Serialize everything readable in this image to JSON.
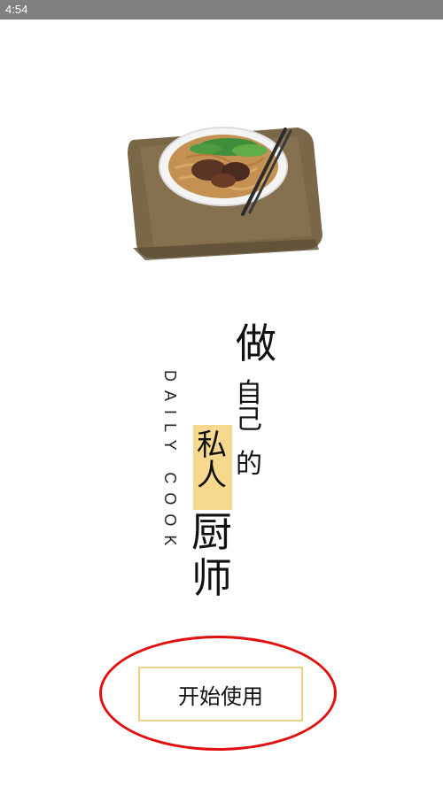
{
  "status_bar": {
    "time": "4:54"
  },
  "hero": {
    "english_title": "DAILY COOK",
    "chinese_lines": [
      "做",
      "自己",
      "的",
      "私人",
      "厨",
      "师"
    ]
  },
  "start_button": {
    "label": "开始使用"
  }
}
